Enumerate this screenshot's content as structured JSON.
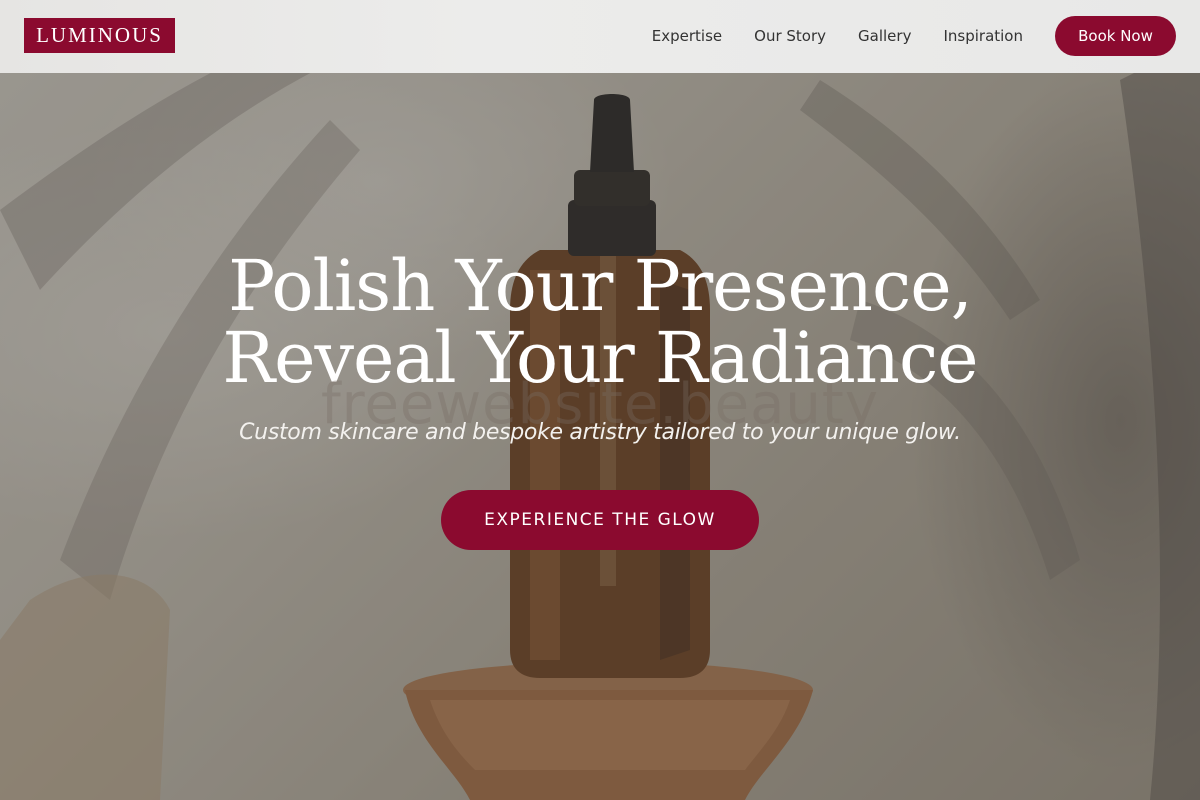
{
  "brand": {
    "logo_text": "LUMINOUS"
  },
  "nav": {
    "links": [
      {
        "label": "Expertise"
      },
      {
        "label": "Our Story"
      },
      {
        "label": "Gallery"
      },
      {
        "label": "Inspiration"
      }
    ],
    "book_label": "Book Now"
  },
  "hero": {
    "title_line1": "Polish Your Presence,",
    "title_line2": "Reveal Your Radiance",
    "watermark": "freewebsite.beauty",
    "subtitle": "Custom skincare and bespoke artistry tailored to your unique glow.",
    "cta_label": "EXPERIENCE THE GLOW"
  },
  "colors": {
    "accent": "#8b0a2f",
    "header_bg": "#e9e9e8",
    "nav_text": "#333333",
    "hero_text": "#ffffff"
  }
}
